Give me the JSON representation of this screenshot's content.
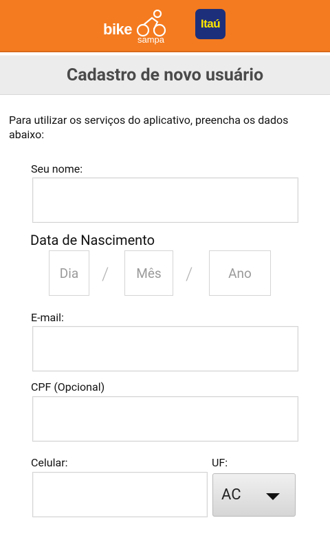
{
  "header": {
    "brand_bike": "bike",
    "brand_sampa": "sampa",
    "brand_itau": "Itaú",
    "background_color": "#f47b20"
  },
  "title": "Cadastro de novo usuário",
  "intro": "Para utilizar os serviços do aplicativo, preencha os dados abaixo:",
  "form": {
    "name_label": "Seu nome:",
    "name_value": "",
    "birth_label": "Data de Nascimento",
    "day_placeholder": "Dia",
    "month_placeholder": "Mês",
    "year_placeholder": "Ano",
    "separator": "/",
    "email_label": "E-mail:",
    "email_value": "",
    "cpf_label": "CPF (Opcional)",
    "cpf_value": "",
    "phone_label": "Celular:",
    "phone_value": "",
    "uf_label": "UF:",
    "uf_value": "AC"
  },
  "icons": {
    "cyclist": "cyclist-logo-icon",
    "dropdown": "triangle-down-icon"
  }
}
